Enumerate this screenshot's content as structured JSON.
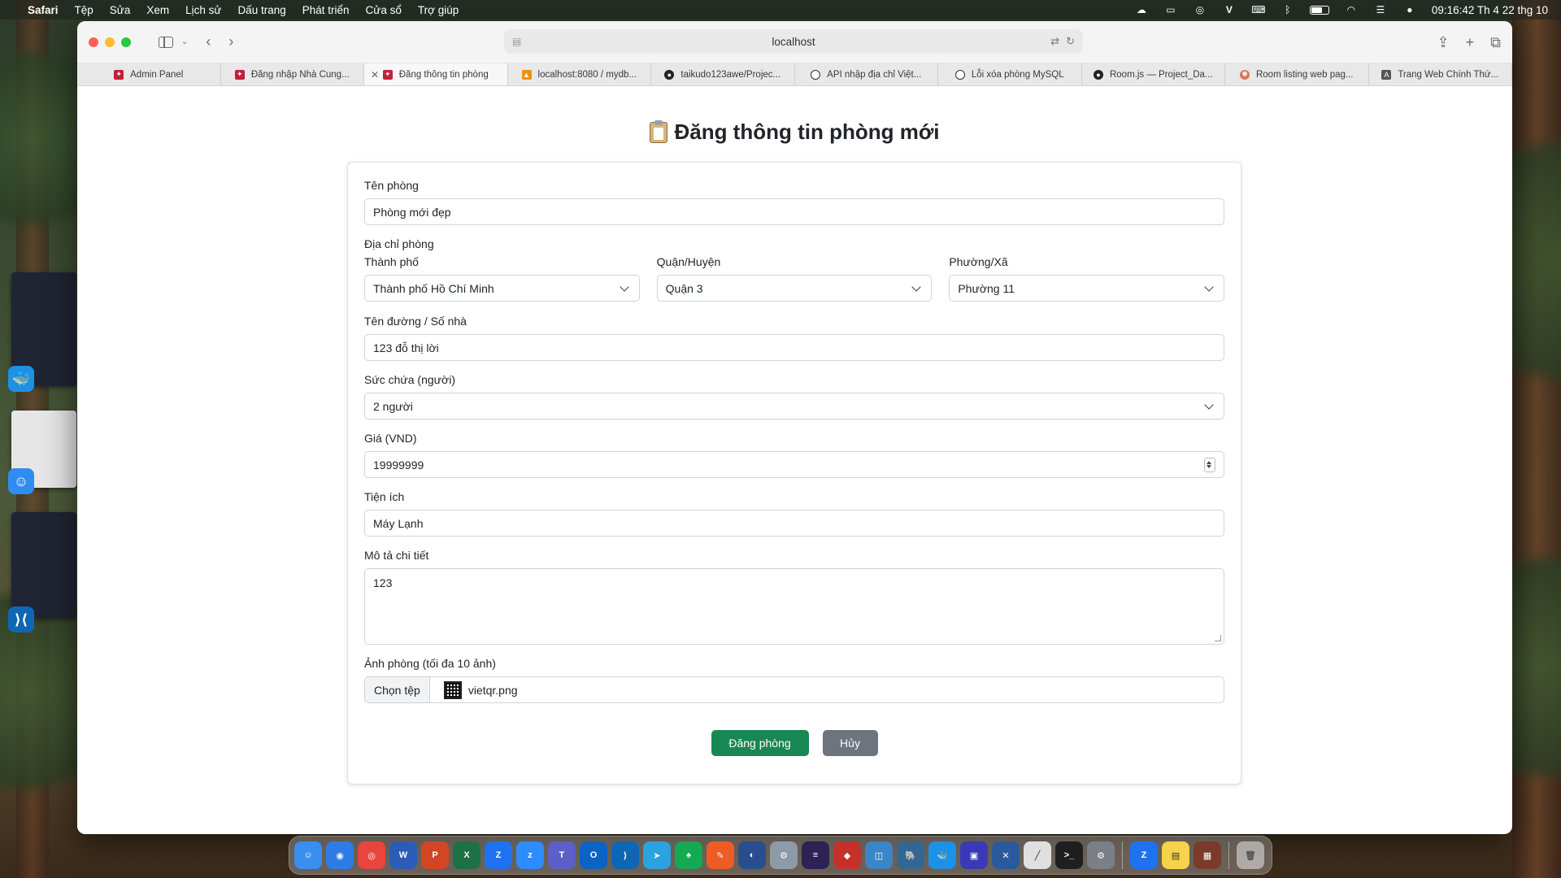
{
  "menubar": {
    "app_name": "Safari",
    "items": [
      "Tệp",
      "Sửa",
      "Xem",
      "Lịch sử",
      "Dấu trang",
      "Phát triển",
      "Cửa sổ",
      "Trợ giúp"
    ],
    "clock": "09:16:42 Th 4 22 thg 10"
  },
  "browser": {
    "address": "localhost",
    "tabs": [
      {
        "label": "Admin Panel",
        "icon": "red-logo-icon"
      },
      {
        "label": "Đăng nhập Nhà Cung...",
        "icon": "red-logo-icon"
      },
      {
        "label": "Đăng thông tin phòng",
        "icon": "red-logo-icon",
        "active": true
      },
      {
        "label": "localhost:8080 / mydb...",
        "icon": "phpmyadmin-icon"
      },
      {
        "label": "taikudo123awe/Projec...",
        "icon": "github-icon"
      },
      {
        "label": "API nhập địa chỉ Việt...",
        "icon": "openai-icon"
      },
      {
        "label": "Lỗi xóa phòng MySQL",
        "icon": "openai-icon"
      },
      {
        "label": "Room.js — Project_Da...",
        "icon": "github-icon"
      },
      {
        "label": "Room listing web pag...",
        "icon": "claude-icon"
      },
      {
        "label": "Trang Web Chính Thứ...",
        "icon": "a-icon"
      }
    ]
  },
  "page": {
    "title": "Đăng thông tin phòng mới"
  },
  "form": {
    "room_name": {
      "label": "Tên phòng",
      "value": "Phòng mới đẹp"
    },
    "address_label": "Địa chỉ phòng",
    "city": {
      "label": "Thành phố",
      "value": "Thành phố Hồ Chí Minh"
    },
    "district": {
      "label": "Quận/Huyện",
      "value": "Quận 3"
    },
    "ward": {
      "label": "Phường/Xã",
      "value": "Phường 11"
    },
    "street": {
      "label": "Tên đường / Số nhà",
      "value": "123 đỗ thị lời"
    },
    "capacity": {
      "label": "Sức chứa (người)",
      "value": "2 người"
    },
    "price": {
      "label": "Giá (VND)",
      "value": "19999999"
    },
    "amenities": {
      "label": "Tiện ích",
      "value": "Máy Lạnh"
    },
    "description": {
      "label": "Mô tả chi tiết",
      "value": "123"
    },
    "images": {
      "label": "Ảnh phòng (tối đa 10 ảnh)",
      "choose_label": "Chọn tệp",
      "file_name": "vietqr.png"
    },
    "submit_label": "Đăng phòng",
    "cancel_label": "Hủy"
  },
  "colors": {
    "submit": "#198754",
    "cancel": "#6c757d",
    "tab_favicon": "#c0213a"
  }
}
